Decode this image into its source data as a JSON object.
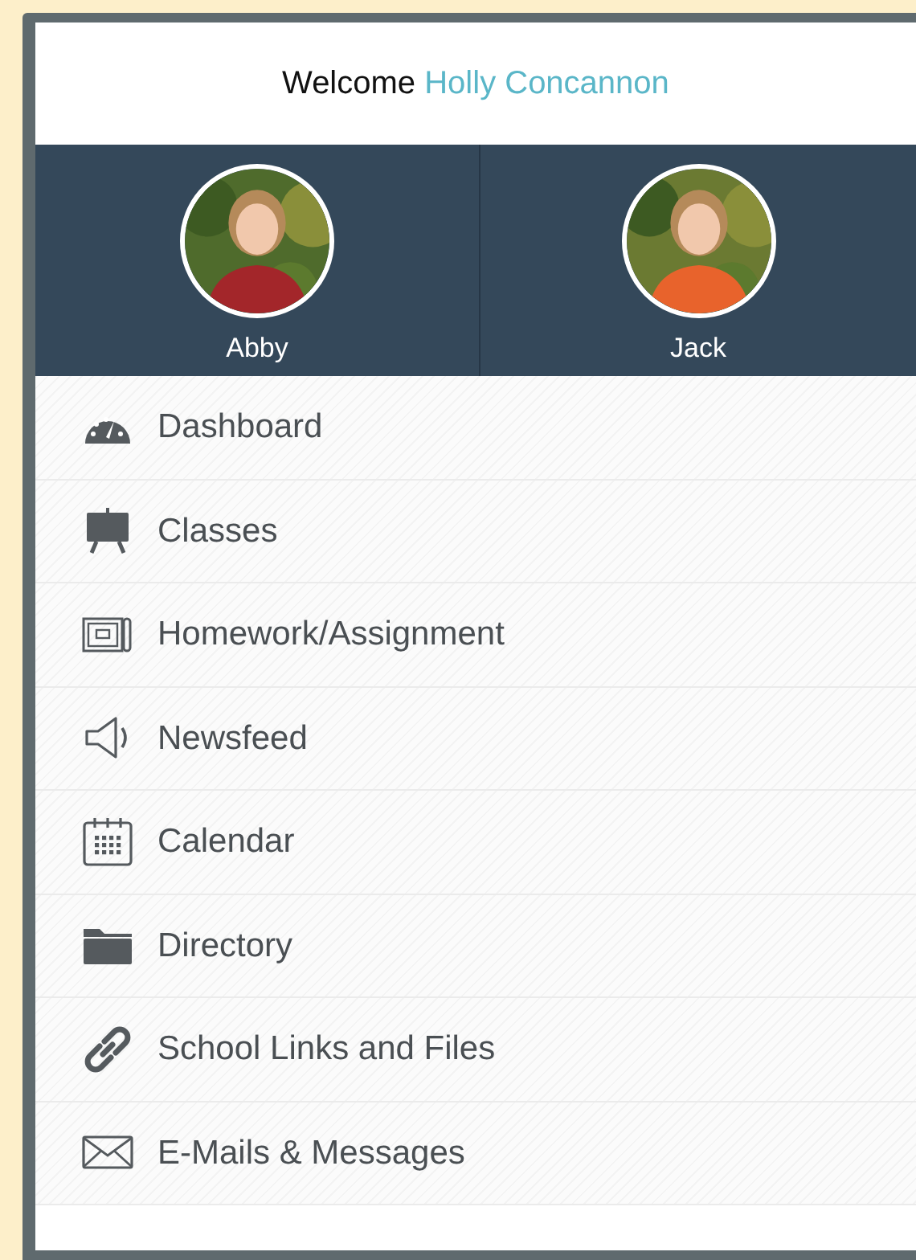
{
  "header": {
    "greeting": "Welcome",
    "user_name": "Holly Concannon"
  },
  "children": [
    {
      "name": "Abby",
      "kind": "picture"
    },
    {
      "name": "Jack",
      "kind": "picture"
    }
  ],
  "menu": [
    {
      "label": "Dashboard"
    },
    {
      "label": "Classes"
    },
    {
      "label": "Homework/Assignment"
    },
    {
      "label": "Newsfeed"
    },
    {
      "label": "Calendar"
    },
    {
      "label": "Directory"
    },
    {
      "label": "School Links and Files"
    },
    {
      "label": "E-Mails & Messages"
    }
  ]
}
